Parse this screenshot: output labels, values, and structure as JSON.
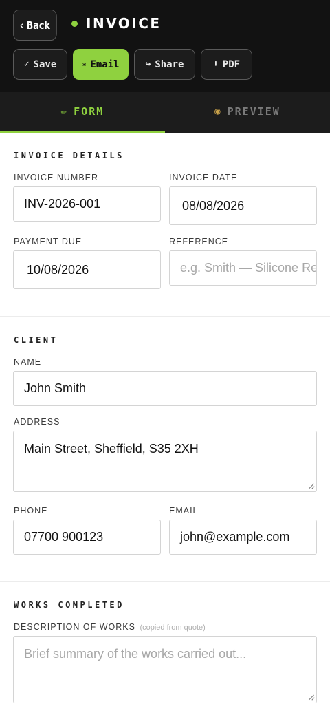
{
  "header": {
    "back_label": "‹ Back",
    "title": "INVOICE",
    "status_color": "#8fd13f"
  },
  "toolbar": {
    "save": {
      "icon": "check-icon",
      "glyph": "✓",
      "label": "Save"
    },
    "email": {
      "icon": "envelope-icon",
      "glyph": "✉",
      "label": "Email"
    },
    "share": {
      "icon": "share-arrow-icon",
      "glyph": "↪",
      "label": "Share"
    },
    "pdf": {
      "icon": "download-icon",
      "glyph": "⬇",
      "label": "PDF"
    }
  },
  "tabs": [
    {
      "icon": "pencil-icon",
      "glyph": "✏",
      "label": "FORM",
      "active": true
    },
    {
      "icon": "eye-icon",
      "glyph": "◉",
      "label": "PREVIEW",
      "active": false
    }
  ],
  "invoice_details": {
    "title": "INVOICE DETAILS",
    "invoice_number": {
      "label": "INVOICE NUMBER",
      "value": "INV-2026-001"
    },
    "invoice_date": {
      "label": "INVOICE DATE",
      "value": "08/08/2026"
    },
    "payment_due": {
      "label": "PAYMENT DUE",
      "value": "10/08/2026"
    },
    "reference": {
      "label": "REFERENCE",
      "placeholder": "e.g. Smith — Silicone Re"
    }
  },
  "client": {
    "title": "CLIENT",
    "name": {
      "label": "NAME",
      "value": "John Smith"
    },
    "address": {
      "label": "ADDRESS",
      "value": "Main Street, Sheffield, S35 2XH"
    },
    "phone": {
      "label": "PHONE",
      "value": "07700 900123"
    },
    "email": {
      "label": "EMAIL",
      "value": "john@example.com"
    }
  },
  "works": {
    "title": "WORKS COMPLETED",
    "description": {
      "label": "DESCRIPTION OF WORKS",
      "hint": "(copied from quote)",
      "placeholder": "Brief summary of the works carried out..."
    }
  },
  "colors": {
    "accent": "#8fd13f",
    "header_bg": "#121212",
    "tabbar_bg": "#1c1c1c"
  }
}
